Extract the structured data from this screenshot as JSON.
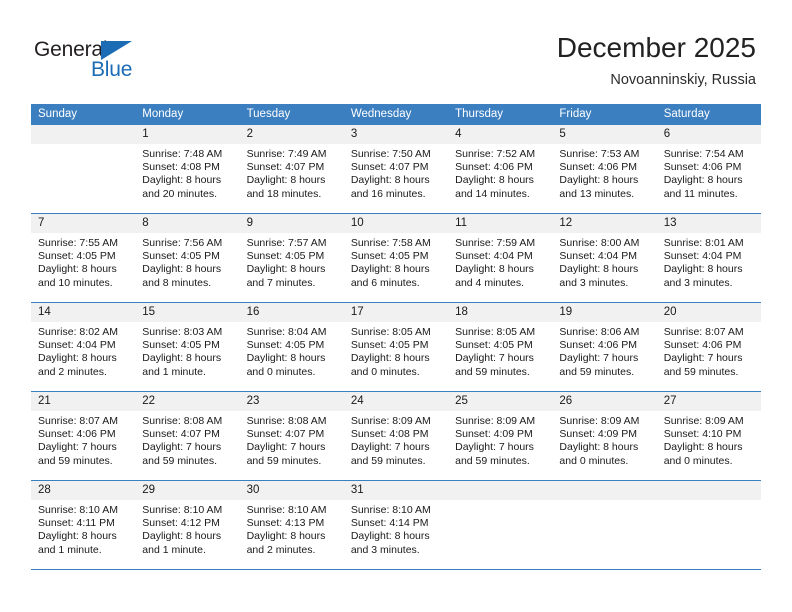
{
  "brand": {
    "name_part1": "General",
    "name_part2": "Blue",
    "accent_color": "#1c6cb5"
  },
  "header": {
    "title": "December 2025",
    "subtitle": "Novoanninskiy, Russia"
  },
  "calendar": {
    "header_bg": "#3c7fc1",
    "weekdays": [
      "Sunday",
      "Monday",
      "Tuesday",
      "Wednesday",
      "Thursday",
      "Friday",
      "Saturday"
    ],
    "weeks": [
      [
        {
          "day": "",
          "sunrise": "",
          "sunset": "",
          "daylight1": "",
          "daylight2": ""
        },
        {
          "day": "1",
          "sunrise": "Sunrise: 7:48 AM",
          "sunset": "Sunset: 4:08 PM",
          "daylight1": "Daylight: 8 hours",
          "daylight2": "and 20 minutes."
        },
        {
          "day": "2",
          "sunrise": "Sunrise: 7:49 AM",
          "sunset": "Sunset: 4:07 PM",
          "daylight1": "Daylight: 8 hours",
          "daylight2": "and 18 minutes."
        },
        {
          "day": "3",
          "sunrise": "Sunrise: 7:50 AM",
          "sunset": "Sunset: 4:07 PM",
          "daylight1": "Daylight: 8 hours",
          "daylight2": "and 16 minutes."
        },
        {
          "day": "4",
          "sunrise": "Sunrise: 7:52 AM",
          "sunset": "Sunset: 4:06 PM",
          "daylight1": "Daylight: 8 hours",
          "daylight2": "and 14 minutes."
        },
        {
          "day": "5",
          "sunrise": "Sunrise: 7:53 AM",
          "sunset": "Sunset: 4:06 PM",
          "daylight1": "Daylight: 8 hours",
          "daylight2": "and 13 minutes."
        },
        {
          "day": "6",
          "sunrise": "Sunrise: 7:54 AM",
          "sunset": "Sunset: 4:06 PM",
          "daylight1": "Daylight: 8 hours",
          "daylight2": "and 11 minutes."
        }
      ],
      [
        {
          "day": "7",
          "sunrise": "Sunrise: 7:55 AM",
          "sunset": "Sunset: 4:05 PM",
          "daylight1": "Daylight: 8 hours",
          "daylight2": "and 10 minutes."
        },
        {
          "day": "8",
          "sunrise": "Sunrise: 7:56 AM",
          "sunset": "Sunset: 4:05 PM",
          "daylight1": "Daylight: 8 hours",
          "daylight2": "and 8 minutes."
        },
        {
          "day": "9",
          "sunrise": "Sunrise: 7:57 AM",
          "sunset": "Sunset: 4:05 PM",
          "daylight1": "Daylight: 8 hours",
          "daylight2": "and 7 minutes."
        },
        {
          "day": "10",
          "sunrise": "Sunrise: 7:58 AM",
          "sunset": "Sunset: 4:05 PM",
          "daylight1": "Daylight: 8 hours",
          "daylight2": "and 6 minutes."
        },
        {
          "day": "11",
          "sunrise": "Sunrise: 7:59 AM",
          "sunset": "Sunset: 4:04 PM",
          "daylight1": "Daylight: 8 hours",
          "daylight2": "and 4 minutes."
        },
        {
          "day": "12",
          "sunrise": "Sunrise: 8:00 AM",
          "sunset": "Sunset: 4:04 PM",
          "daylight1": "Daylight: 8 hours",
          "daylight2": "and 3 minutes."
        },
        {
          "day": "13",
          "sunrise": "Sunrise: 8:01 AM",
          "sunset": "Sunset: 4:04 PM",
          "daylight1": "Daylight: 8 hours",
          "daylight2": "and 3 minutes."
        }
      ],
      [
        {
          "day": "14",
          "sunrise": "Sunrise: 8:02 AM",
          "sunset": "Sunset: 4:04 PM",
          "daylight1": "Daylight: 8 hours",
          "daylight2": "and 2 minutes."
        },
        {
          "day": "15",
          "sunrise": "Sunrise: 8:03 AM",
          "sunset": "Sunset: 4:05 PM",
          "daylight1": "Daylight: 8 hours",
          "daylight2": "and 1 minute."
        },
        {
          "day": "16",
          "sunrise": "Sunrise: 8:04 AM",
          "sunset": "Sunset: 4:05 PM",
          "daylight1": "Daylight: 8 hours",
          "daylight2": "and 0 minutes."
        },
        {
          "day": "17",
          "sunrise": "Sunrise: 8:05 AM",
          "sunset": "Sunset: 4:05 PM",
          "daylight1": "Daylight: 8 hours",
          "daylight2": "and 0 minutes."
        },
        {
          "day": "18",
          "sunrise": "Sunrise: 8:05 AM",
          "sunset": "Sunset: 4:05 PM",
          "daylight1": "Daylight: 7 hours",
          "daylight2": "and 59 minutes."
        },
        {
          "day": "19",
          "sunrise": "Sunrise: 8:06 AM",
          "sunset": "Sunset: 4:06 PM",
          "daylight1": "Daylight: 7 hours",
          "daylight2": "and 59 minutes."
        },
        {
          "day": "20",
          "sunrise": "Sunrise: 8:07 AM",
          "sunset": "Sunset: 4:06 PM",
          "daylight1": "Daylight: 7 hours",
          "daylight2": "and 59 minutes."
        }
      ],
      [
        {
          "day": "21",
          "sunrise": "Sunrise: 8:07 AM",
          "sunset": "Sunset: 4:06 PM",
          "daylight1": "Daylight: 7 hours",
          "daylight2": "and 59 minutes."
        },
        {
          "day": "22",
          "sunrise": "Sunrise: 8:08 AM",
          "sunset": "Sunset: 4:07 PM",
          "daylight1": "Daylight: 7 hours",
          "daylight2": "and 59 minutes."
        },
        {
          "day": "23",
          "sunrise": "Sunrise: 8:08 AM",
          "sunset": "Sunset: 4:07 PM",
          "daylight1": "Daylight: 7 hours",
          "daylight2": "and 59 minutes."
        },
        {
          "day": "24",
          "sunrise": "Sunrise: 8:09 AM",
          "sunset": "Sunset: 4:08 PM",
          "daylight1": "Daylight: 7 hours",
          "daylight2": "and 59 minutes."
        },
        {
          "day": "25",
          "sunrise": "Sunrise: 8:09 AM",
          "sunset": "Sunset: 4:09 PM",
          "daylight1": "Daylight: 7 hours",
          "daylight2": "and 59 minutes."
        },
        {
          "day": "26",
          "sunrise": "Sunrise: 8:09 AM",
          "sunset": "Sunset: 4:09 PM",
          "daylight1": "Daylight: 8 hours",
          "daylight2": "and 0 minutes."
        },
        {
          "day": "27",
          "sunrise": "Sunrise: 8:09 AM",
          "sunset": "Sunset: 4:10 PM",
          "daylight1": "Daylight: 8 hours",
          "daylight2": "and 0 minutes."
        }
      ],
      [
        {
          "day": "28",
          "sunrise": "Sunrise: 8:10 AM",
          "sunset": "Sunset: 4:11 PM",
          "daylight1": "Daylight: 8 hours",
          "daylight2": "and 1 minute."
        },
        {
          "day": "29",
          "sunrise": "Sunrise: 8:10 AM",
          "sunset": "Sunset: 4:12 PM",
          "daylight1": "Daylight: 8 hours",
          "daylight2": "and 1 minute."
        },
        {
          "day": "30",
          "sunrise": "Sunrise: 8:10 AM",
          "sunset": "Sunset: 4:13 PM",
          "daylight1": "Daylight: 8 hours",
          "daylight2": "and 2 minutes."
        },
        {
          "day": "31",
          "sunrise": "Sunrise: 8:10 AM",
          "sunset": "Sunset: 4:14 PM",
          "daylight1": "Daylight: 8 hours",
          "daylight2": "and 3 minutes."
        },
        {
          "day": "",
          "sunrise": "",
          "sunset": "",
          "daylight1": "",
          "daylight2": ""
        },
        {
          "day": "",
          "sunrise": "",
          "sunset": "",
          "daylight1": "",
          "daylight2": ""
        },
        {
          "day": "",
          "sunrise": "",
          "sunset": "",
          "daylight1": "",
          "daylight2": ""
        }
      ]
    ]
  }
}
